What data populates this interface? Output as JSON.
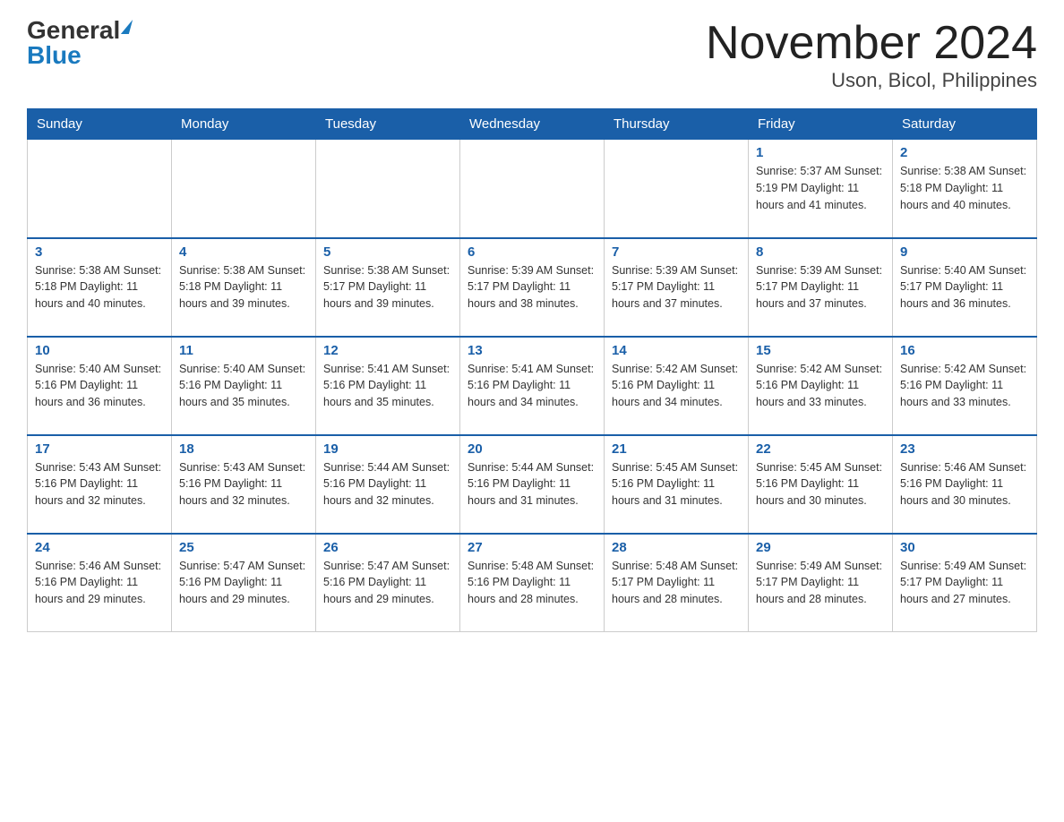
{
  "header": {
    "logo_general": "General",
    "logo_blue": "Blue",
    "month_title": "November 2024",
    "location": "Uson, Bicol, Philippines"
  },
  "days_of_week": [
    "Sunday",
    "Monday",
    "Tuesday",
    "Wednesday",
    "Thursday",
    "Friday",
    "Saturday"
  ],
  "weeks": [
    [
      {
        "day": "",
        "info": ""
      },
      {
        "day": "",
        "info": ""
      },
      {
        "day": "",
        "info": ""
      },
      {
        "day": "",
        "info": ""
      },
      {
        "day": "",
        "info": ""
      },
      {
        "day": "1",
        "info": "Sunrise: 5:37 AM\nSunset: 5:19 PM\nDaylight: 11 hours and 41 minutes."
      },
      {
        "day": "2",
        "info": "Sunrise: 5:38 AM\nSunset: 5:18 PM\nDaylight: 11 hours and 40 minutes."
      }
    ],
    [
      {
        "day": "3",
        "info": "Sunrise: 5:38 AM\nSunset: 5:18 PM\nDaylight: 11 hours and 40 minutes."
      },
      {
        "day": "4",
        "info": "Sunrise: 5:38 AM\nSunset: 5:18 PM\nDaylight: 11 hours and 39 minutes."
      },
      {
        "day": "5",
        "info": "Sunrise: 5:38 AM\nSunset: 5:17 PM\nDaylight: 11 hours and 39 minutes."
      },
      {
        "day": "6",
        "info": "Sunrise: 5:39 AM\nSunset: 5:17 PM\nDaylight: 11 hours and 38 minutes."
      },
      {
        "day": "7",
        "info": "Sunrise: 5:39 AM\nSunset: 5:17 PM\nDaylight: 11 hours and 37 minutes."
      },
      {
        "day": "8",
        "info": "Sunrise: 5:39 AM\nSunset: 5:17 PM\nDaylight: 11 hours and 37 minutes."
      },
      {
        "day": "9",
        "info": "Sunrise: 5:40 AM\nSunset: 5:17 PM\nDaylight: 11 hours and 36 minutes."
      }
    ],
    [
      {
        "day": "10",
        "info": "Sunrise: 5:40 AM\nSunset: 5:16 PM\nDaylight: 11 hours and 36 minutes."
      },
      {
        "day": "11",
        "info": "Sunrise: 5:40 AM\nSunset: 5:16 PM\nDaylight: 11 hours and 35 minutes."
      },
      {
        "day": "12",
        "info": "Sunrise: 5:41 AM\nSunset: 5:16 PM\nDaylight: 11 hours and 35 minutes."
      },
      {
        "day": "13",
        "info": "Sunrise: 5:41 AM\nSunset: 5:16 PM\nDaylight: 11 hours and 34 minutes."
      },
      {
        "day": "14",
        "info": "Sunrise: 5:42 AM\nSunset: 5:16 PM\nDaylight: 11 hours and 34 minutes."
      },
      {
        "day": "15",
        "info": "Sunrise: 5:42 AM\nSunset: 5:16 PM\nDaylight: 11 hours and 33 minutes."
      },
      {
        "day": "16",
        "info": "Sunrise: 5:42 AM\nSunset: 5:16 PM\nDaylight: 11 hours and 33 minutes."
      }
    ],
    [
      {
        "day": "17",
        "info": "Sunrise: 5:43 AM\nSunset: 5:16 PM\nDaylight: 11 hours and 32 minutes."
      },
      {
        "day": "18",
        "info": "Sunrise: 5:43 AM\nSunset: 5:16 PM\nDaylight: 11 hours and 32 minutes."
      },
      {
        "day": "19",
        "info": "Sunrise: 5:44 AM\nSunset: 5:16 PM\nDaylight: 11 hours and 32 minutes."
      },
      {
        "day": "20",
        "info": "Sunrise: 5:44 AM\nSunset: 5:16 PM\nDaylight: 11 hours and 31 minutes."
      },
      {
        "day": "21",
        "info": "Sunrise: 5:45 AM\nSunset: 5:16 PM\nDaylight: 11 hours and 31 minutes."
      },
      {
        "day": "22",
        "info": "Sunrise: 5:45 AM\nSunset: 5:16 PM\nDaylight: 11 hours and 30 minutes."
      },
      {
        "day": "23",
        "info": "Sunrise: 5:46 AM\nSunset: 5:16 PM\nDaylight: 11 hours and 30 minutes."
      }
    ],
    [
      {
        "day": "24",
        "info": "Sunrise: 5:46 AM\nSunset: 5:16 PM\nDaylight: 11 hours and 29 minutes."
      },
      {
        "day": "25",
        "info": "Sunrise: 5:47 AM\nSunset: 5:16 PM\nDaylight: 11 hours and 29 minutes."
      },
      {
        "day": "26",
        "info": "Sunrise: 5:47 AM\nSunset: 5:16 PM\nDaylight: 11 hours and 29 minutes."
      },
      {
        "day": "27",
        "info": "Sunrise: 5:48 AM\nSunset: 5:16 PM\nDaylight: 11 hours and 28 minutes."
      },
      {
        "day": "28",
        "info": "Sunrise: 5:48 AM\nSunset: 5:17 PM\nDaylight: 11 hours and 28 minutes."
      },
      {
        "day": "29",
        "info": "Sunrise: 5:49 AM\nSunset: 5:17 PM\nDaylight: 11 hours and 28 minutes."
      },
      {
        "day": "30",
        "info": "Sunrise: 5:49 AM\nSunset: 5:17 PM\nDaylight: 11 hours and 27 minutes."
      }
    ]
  ]
}
